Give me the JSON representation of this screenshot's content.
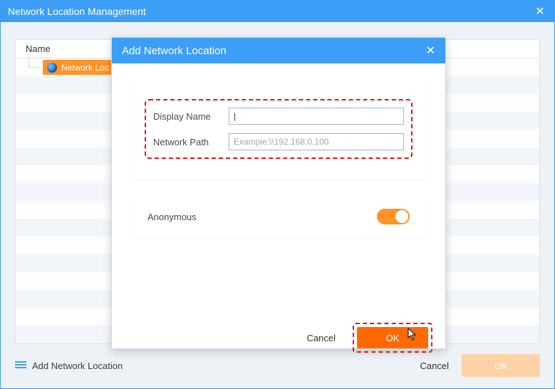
{
  "main": {
    "title": "Network Location Management",
    "list_header": "Name",
    "selected_item": "Network Loc",
    "footer": {
      "add_label": "Add Network Location",
      "cancel": "Cancel",
      "ok": "OK"
    }
  },
  "modal": {
    "title": "Add Network Location",
    "fields": {
      "display_label": "Display Name",
      "display_value": "|",
      "path_label": "Network Path",
      "path_placeholder": "Example:\\\\192.168.0.100"
    },
    "anonymous_label": "Anonymous",
    "anonymous_on": true,
    "buttons": {
      "cancel": "Cancel",
      "ok": "OK"
    }
  }
}
